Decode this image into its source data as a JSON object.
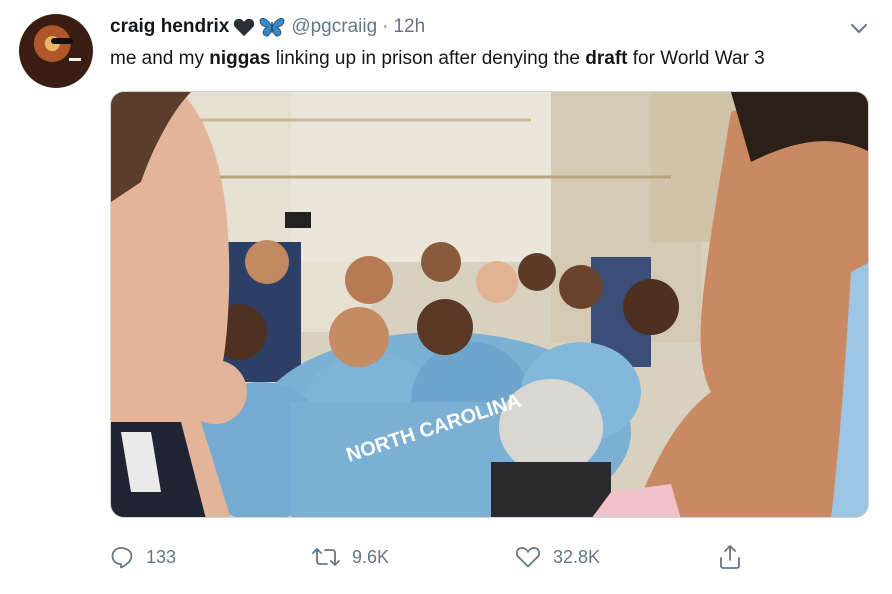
{
  "tweet": {
    "author_name": "craig hendrix",
    "handle": "@pgcraiig",
    "separator": "·",
    "time": "12h",
    "text_parts": {
      "p1": "me and my ",
      "b1": "niggas",
      "p2": " linking up in prison after denying the ",
      "b2": "draft",
      "p3": " for World War 3"
    }
  },
  "actions": {
    "reply_count": "133",
    "retweet_count": "9.6K",
    "like_count": "32.8K"
  },
  "icons": {
    "avatar": "avatar-image",
    "emoji1": "black-heart-icon",
    "emoji2": "butterfly-icon",
    "menu": "chevron-down-icon",
    "reply": "reply-icon",
    "retweet": "retweet-icon",
    "like": "heart-icon",
    "share": "share-icon"
  },
  "colors": {
    "text": "#14171a",
    "secondary": "#657786",
    "carolina_blue": "#7bafd4",
    "butterfly": "#3b88c3"
  },
  "media": {
    "jersey_text": "NORTH CAROLINA"
  }
}
